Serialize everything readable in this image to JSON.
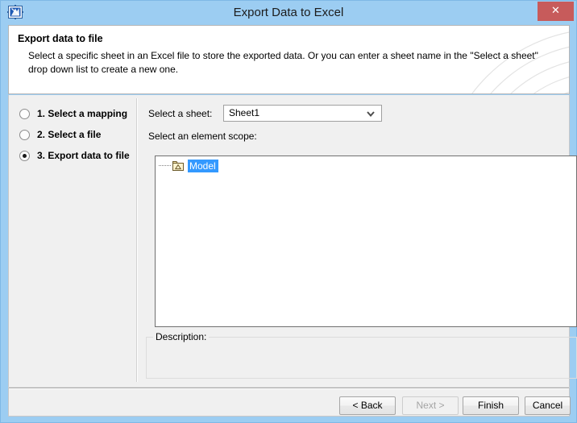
{
  "window": {
    "title": "Export Data to Excel",
    "app_icon": "magicdraw-icon",
    "close_label": "✕",
    "titlebar_color": "#9ccdf2",
    "close_button_color": "#c75b5b"
  },
  "header": {
    "title": "Export data to file",
    "description": "Select a specific sheet in an Excel file to store the exported data. Or you can enter a sheet name in the \"Select a sheet\" drop down list to create a new one."
  },
  "steps": {
    "items": [
      {
        "label": "1. Select a mapping",
        "selected": false
      },
      {
        "label": "2. Select a file",
        "selected": false
      },
      {
        "label": "3. Export data to file",
        "selected": true
      }
    ]
  },
  "content": {
    "sheet_label": "Select a sheet:",
    "sheet_value": "Sheet1",
    "sheet_options": [
      "Sheet1"
    ],
    "sheet_arrow_icon": "chevron-down-icon",
    "scope_label": "Select an element scope:",
    "tree": {
      "nodes": [
        {
          "label": "Model",
          "icon": "model-package-icon",
          "selected": true,
          "selection_color": "#3399ff"
        }
      ]
    },
    "description_legend": "Description:",
    "description_text": ""
  },
  "footer": {
    "buttons": [
      {
        "label": "< Back",
        "enabled": true
      },
      {
        "label": "Next >",
        "enabled": false
      },
      {
        "label": "Finish",
        "enabled": true
      },
      {
        "label": "Cancel",
        "enabled": true
      }
    ]
  }
}
